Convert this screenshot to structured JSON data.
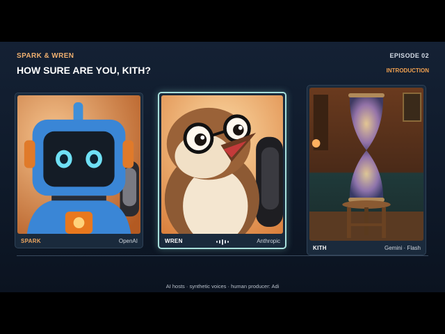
{
  "header": {
    "show_name": "SPARK & WREN",
    "episode_title": "HOW SURE ARE YOU, KITH?",
    "episode_label": "EPISODE 02",
    "segment_label": "INTRODUCTION"
  },
  "hosts": [
    {
      "name": "SPARK",
      "model": "OpenAI",
      "name_color": "#f0a860",
      "speaking": false,
      "icon": "robot-host-portrait"
    },
    {
      "name": "WREN",
      "model": "Anthropic",
      "name_color": "#ffffff",
      "speaking": true,
      "icon": "wren-bird-portrait"
    },
    {
      "name": "KITH",
      "model": "Gemini · Flash",
      "name_color": "#ffffff",
      "speaking": false,
      "icon": "hourglass-portrait"
    }
  ],
  "footer": {
    "credits": "AI hosts · synthetic voices · human producer: Adi"
  },
  "colors": {
    "accent_orange": "#f0a050",
    "active_border": "#a8e0dc",
    "background": "#0f1a2a"
  }
}
